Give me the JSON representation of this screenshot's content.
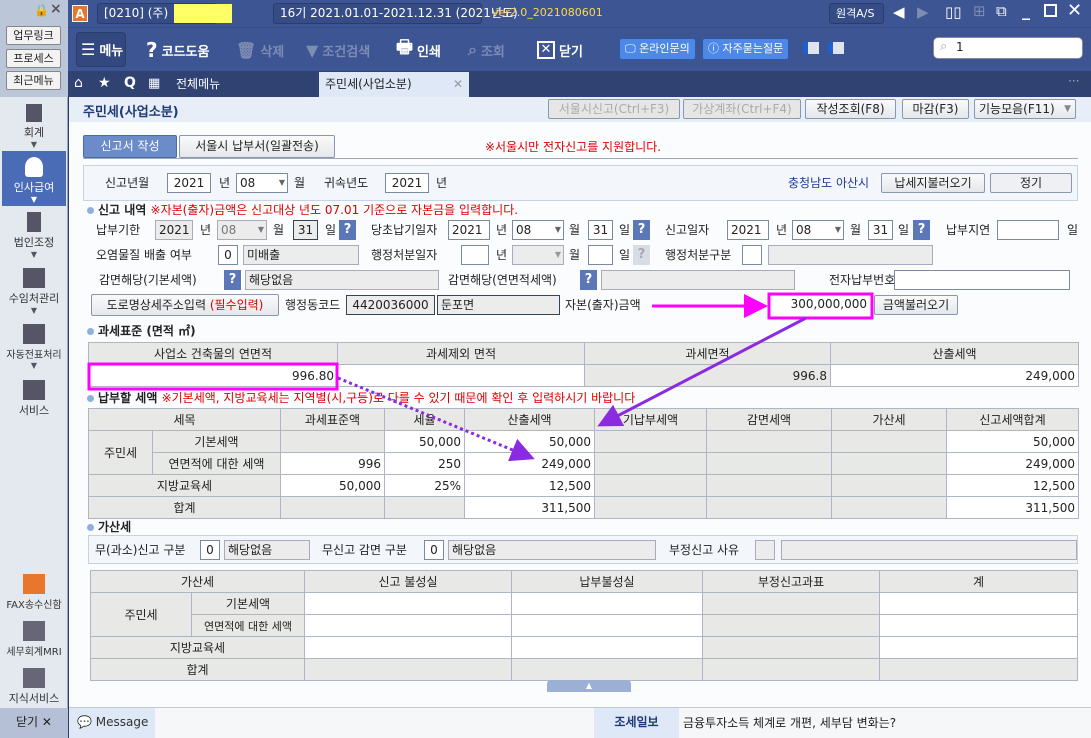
{
  "titlebar": {
    "company_code": "[0210] (주)",
    "period": "16기  2021.01.01-2021.12.31 (2021년도)",
    "version": "ver2.0_2021080601",
    "remote_as": "원격A/S"
  },
  "sidebar": {
    "top_buttons": [
      "업무링크",
      "프로세스",
      "최근메뉴"
    ],
    "items": [
      "회계",
      "인사급여",
      "법인조정",
      "수임처관리",
      "자동전표처리",
      "서비스"
    ],
    "bottom_items": [
      "FAX송수신함",
      "세무회계MRI",
      "지식서비스"
    ],
    "close": "닫기 ✕"
  },
  "toolbar": {
    "menu": "메뉴",
    "code_help": "코드도움",
    "delete": "삭제",
    "condition_search": "조건검색",
    "print": "인쇄",
    "inquiry": "조회",
    "close": "닫기",
    "online_inquiry": "온라인문의",
    "faq": "자주묻는질문",
    "search_value": "1"
  },
  "tabs": {
    "all_menu": "전체메뉴",
    "active": "주민세(사업소분)"
  },
  "page": {
    "title": "주민세(사업소분)",
    "buttons": [
      "서울시신고(Ctrl+F3)",
      "가상계좌(Ctrl+F4)",
      "작성조회(F8)",
      "마감(F3)",
      "기능모음(F11)"
    ],
    "subtabs": [
      "신고서 작성",
      "서울시 납부서(일괄전송)"
    ],
    "notice": "※서울시만 전자신고를 지원합니다."
  },
  "header_form": {
    "report_ym_label": "신고년월",
    "year": "2021",
    "year_unit": "년",
    "month": "08",
    "month_unit": "월",
    "belong_year_label": "귀속년도",
    "belong_year": "2021",
    "belong_year_unit": "년",
    "region": "충청남도 아산시",
    "load_taxpayer": "납세지불러오기",
    "type": "정기"
  },
  "report": {
    "title": "신고 내역",
    "warning": "※자본(출자)금액은 신고대상 년도 07.01 기준으로 자본금을 입력합니다.",
    "due_label": "납부기한",
    "due_year": "2021",
    "due_month": "08",
    "due_day": "31",
    "initial_label": "당초납기일자",
    "initial_year": "2021",
    "initial_month": "08",
    "initial_day": "31",
    "report_date_label": "신고일자",
    "report_year": "2021",
    "report_month": "08",
    "report_day": "31",
    "delay_label": "납부지연",
    "delay_value": "",
    "u_year": "년",
    "u_month": "월",
    "u_day": "일",
    "pollutant_label": "오염물질 배출 여부",
    "pollutant_code": "0",
    "pollutant_value": "미배출",
    "admin_date_label": "행정처분일자",
    "admin_type_label": "행정처분구분",
    "exempt_basic_label": "감면해당(기본세액)",
    "exempt_basic_value": "해당없음",
    "exempt_area_label": "감면해당(연면적세액)",
    "exempt_area_value": "",
    "epay_label": "전자납부번호",
    "epay_value": "",
    "road_address_btn": "도로명상세주소입력",
    "road_address_req": "(필수입력)",
    "admin_code_label": "행정동코드",
    "admin_code": "4420036000",
    "admin_name": "둔포면",
    "capital_label": "자본(출자)금액",
    "capital": "300,000,000",
    "load_amount": "금액불러오기"
  },
  "tax_base": {
    "title": "과세표준 (면적 ㎡)",
    "headers": [
      "사업소 건축물의 연면적",
      "과세제외 면적",
      "과세면적",
      "산출세액"
    ],
    "values": [
      "996.80",
      "",
      "996.8",
      "249,000"
    ]
  },
  "payable": {
    "title": "납부할 세액",
    "warning": "※기본세액, 지방교육세는 지역별(시,구등)로 다를 수 있기 때문에 확인 후 입력하시기 바랍니다",
    "headers": [
      "세목",
      "과세표준액",
      "세율",
      "산출세액",
      "기납부세액",
      "감면세액",
      "가산세",
      "신고세액합계"
    ],
    "group": "주민세",
    "rows": [
      {
        "name": "기본세액",
        "base": "",
        "rate": "50,000",
        "calc": "50,000",
        "prepaid": "",
        "exempt": "",
        "penalty": "",
        "total": "50,000"
      },
      {
        "name": "연면적에 대한 세액",
        "base": "996",
        "rate": "250",
        "calc": "249,000",
        "prepaid": "",
        "exempt": "",
        "penalty": "",
        "total": "249,000"
      },
      {
        "name": "지방교육세",
        "base": "50,000",
        "rate": "25%",
        "calc": "12,500",
        "prepaid": "",
        "exempt": "",
        "penalty": "",
        "total": "12,500"
      },
      {
        "name": "합계",
        "base": "",
        "rate": "",
        "calc": "311,500",
        "prepaid": "",
        "exempt": "",
        "penalty": "",
        "total": "311,500"
      }
    ]
  },
  "penalty": {
    "title": "가산세",
    "nonreport_label": "무(과소)신고 구분",
    "nonreport_code": "0",
    "nonreport_value": "해당없음",
    "exempt_label": "무신고 감면 구분",
    "exempt_code": "0",
    "exempt_value": "해당없음",
    "fraud_label": "부정신고 사유",
    "headers": [
      "가산세",
      "신고 불성실",
      "납부불성실",
      "부정신고과표",
      "계"
    ],
    "group": "주민세",
    "rows": [
      "기본세액",
      "연면적에 대한 세액",
      "지방교육세",
      "합계"
    ]
  },
  "statusbar": {
    "message": "Message",
    "news_label": "조세일보",
    "news": "금융투자소득 체계로 개편, 세부담 변화는?"
  },
  "colors": {
    "accent_blue": "#3d5592",
    "highlight": "#ff00ff",
    "arrow": "#8a2be2",
    "warning": "#e00000"
  }
}
